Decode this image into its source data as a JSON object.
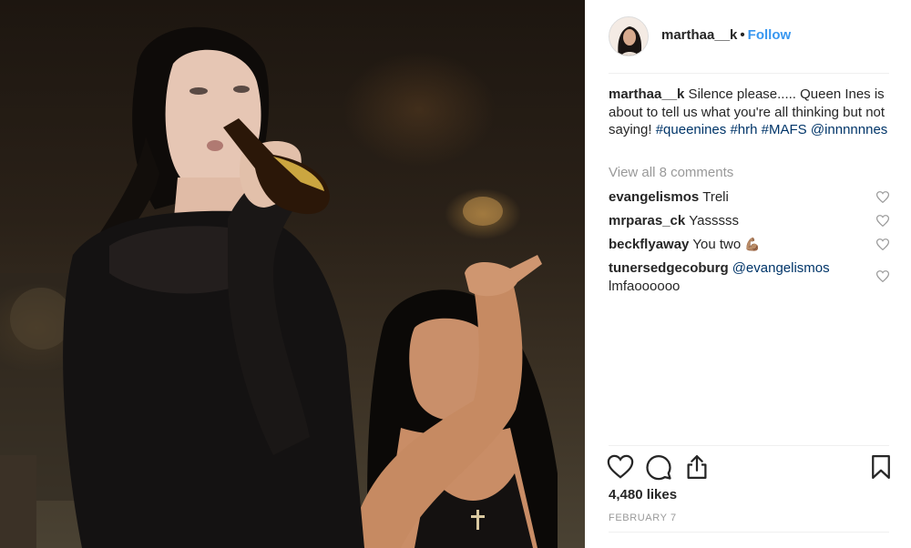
{
  "post": {
    "username": "marthaa__k",
    "separator": "•",
    "follow_label": "Follow",
    "caption": {
      "username": "marthaa__k",
      "text": " Silence please..... Queen Ines is about to tell us what you're all thinking but not saying! ",
      "hashtags": [
        "#queenines",
        "#hrh",
        "#MAFS"
      ],
      "mention": "@innnnnnes"
    },
    "view_all_comments": "View all 8 comments",
    "comments": [
      {
        "username": "evangelismos",
        "text": "Treli",
        "mention": ""
      },
      {
        "username": "mrparas_ck",
        "text": "Yasssss",
        "mention": ""
      },
      {
        "username": "beckflyaway",
        "text": "You two",
        "mention": "",
        "emoji": "💪🏽"
      },
      {
        "username": "tunersedgecoburg",
        "text": "lmfaoooooo",
        "mention": "@evangelismos"
      }
    ],
    "likes": "4,480 likes",
    "date": "FEBRUARY 7"
  },
  "icons": {
    "like": "heart-outline-icon",
    "comment": "comment-bubble-icon",
    "share": "share-upload-icon",
    "save": "bookmark-icon",
    "comment_like": "small-heart-icon"
  },
  "colors": {
    "link_blue": "#3897f0",
    "hashtag_blue": "#003569",
    "muted_gray": "#999999",
    "text": "#262626",
    "divider": "#efefef"
  }
}
